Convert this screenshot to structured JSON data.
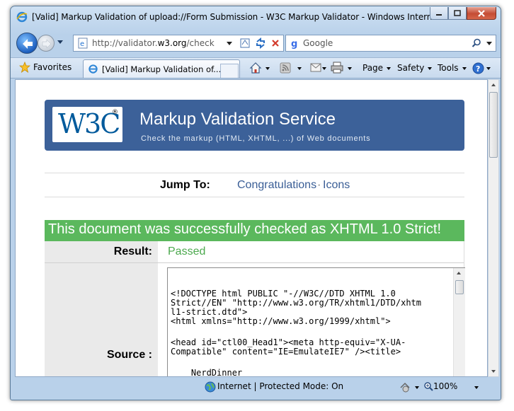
{
  "window": {
    "title": "[Valid] Markup Validation of upload://Form Submission - W3C Markup Validator - Windows Internet E..."
  },
  "address_bar": {
    "url_prefix": "http://validator.",
    "url_domain": "w3.org",
    "url_suffix": "/check",
    "search_placeholder": "Google"
  },
  "favorites_bar": {
    "favorites_label": "Favorites",
    "tab_label": "[Valid] Markup Validation of..."
  },
  "command_bar": {
    "page": "Page",
    "safety": "Safety",
    "tools": "Tools"
  },
  "page": {
    "banner_title": "Markup Validation Service",
    "banner_subtitle": "Check the markup (HTML, XHTML, ...) of Web documents",
    "logo_text": "W3C",
    "logo_reg": "®",
    "jump_to_label": "Jump To:",
    "jump_links": [
      "Congratulations",
      "Icons"
    ],
    "jump_separator": "·",
    "success_message": "This document was successfully checked as XHTML 1.0 Strict!",
    "result_label": "Result:",
    "result_value": "Passed",
    "source_label": "Source :",
    "source_lines": [
      "<!DOCTYPE html PUBLIC \"-//W3C//DTD XHTML 1.0",
      "Strict//EN\" \"http://www.w3.org/TR/xhtml1/DTD/xhtm",
      "l1-strict.dtd\">",
      "<html xmlns=\"http://www.w3.org/1999/xhtml\">",
      "",
      "<head id=\"ctl00_Head1\"><meta http-equiv=\"X-UA-",
      "Compatible\" content=\"IE=EmulateIE7\" /><title>",
      "",
      "    NerdDinner"
    ]
  },
  "status_bar": {
    "zone_text": "Internet | Protected Mode: On",
    "zoom": "100%"
  }
}
